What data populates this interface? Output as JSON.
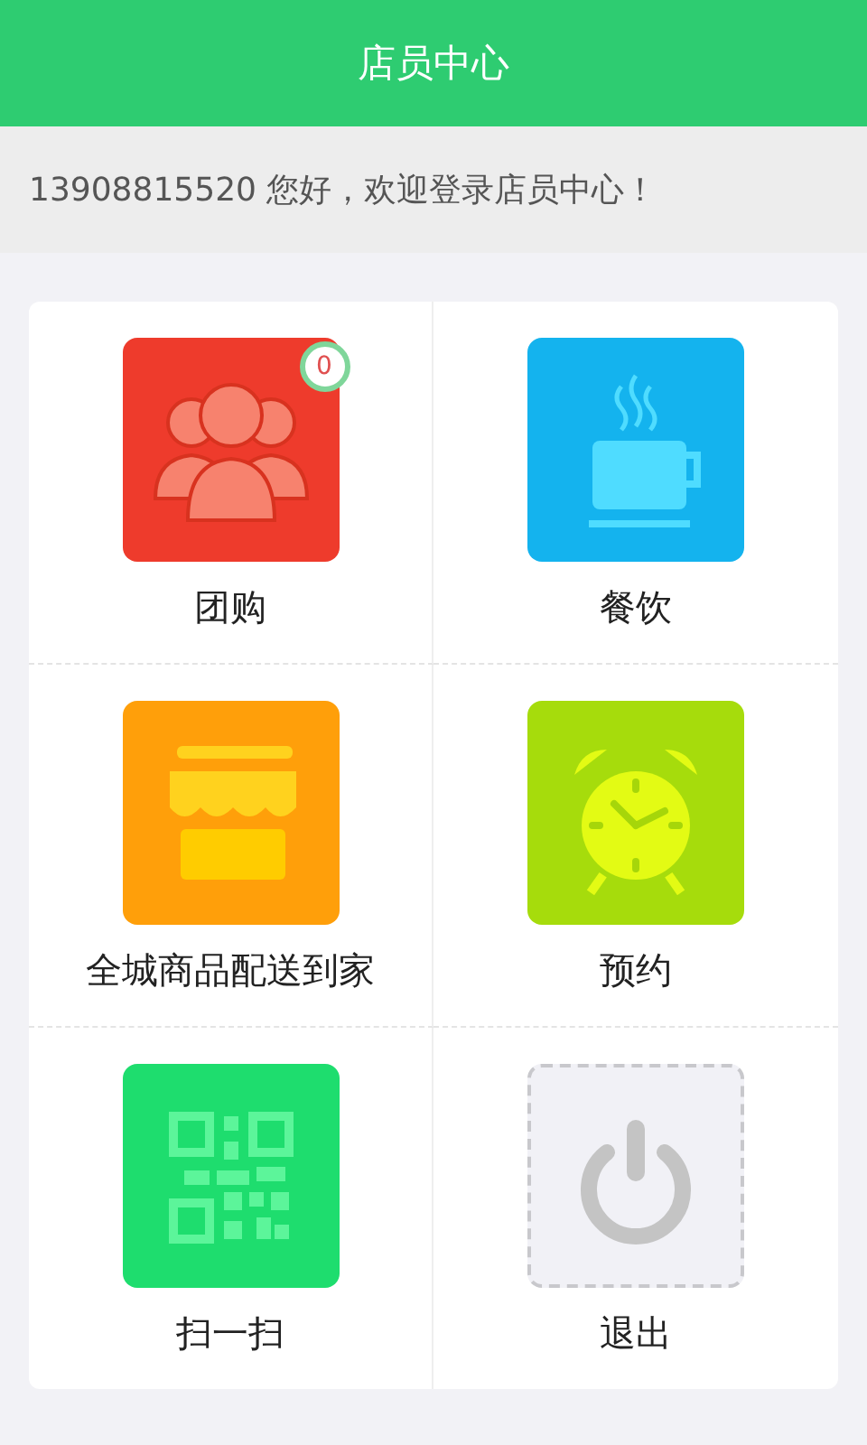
{
  "header": {
    "title": "店员中心"
  },
  "welcome": "13908815520 您好，欢迎登录店员中心！",
  "tiles": [
    {
      "label": "团购",
      "kind": "group",
      "color": "#ee3b2c",
      "badge": "0"
    },
    {
      "label": "餐饮",
      "kind": "cup",
      "color": "#14b3ee"
    },
    {
      "label": "全城商品配送到家",
      "kind": "store",
      "color": "#ff9f0a"
    },
    {
      "label": "预约",
      "kind": "clock",
      "color": "#a6dc0c"
    },
    {
      "label": "扫一扫",
      "kind": "qr",
      "color": "#1edd6e"
    },
    {
      "label": "退出",
      "kind": "power",
      "color": "#f1f1f6"
    }
  ]
}
